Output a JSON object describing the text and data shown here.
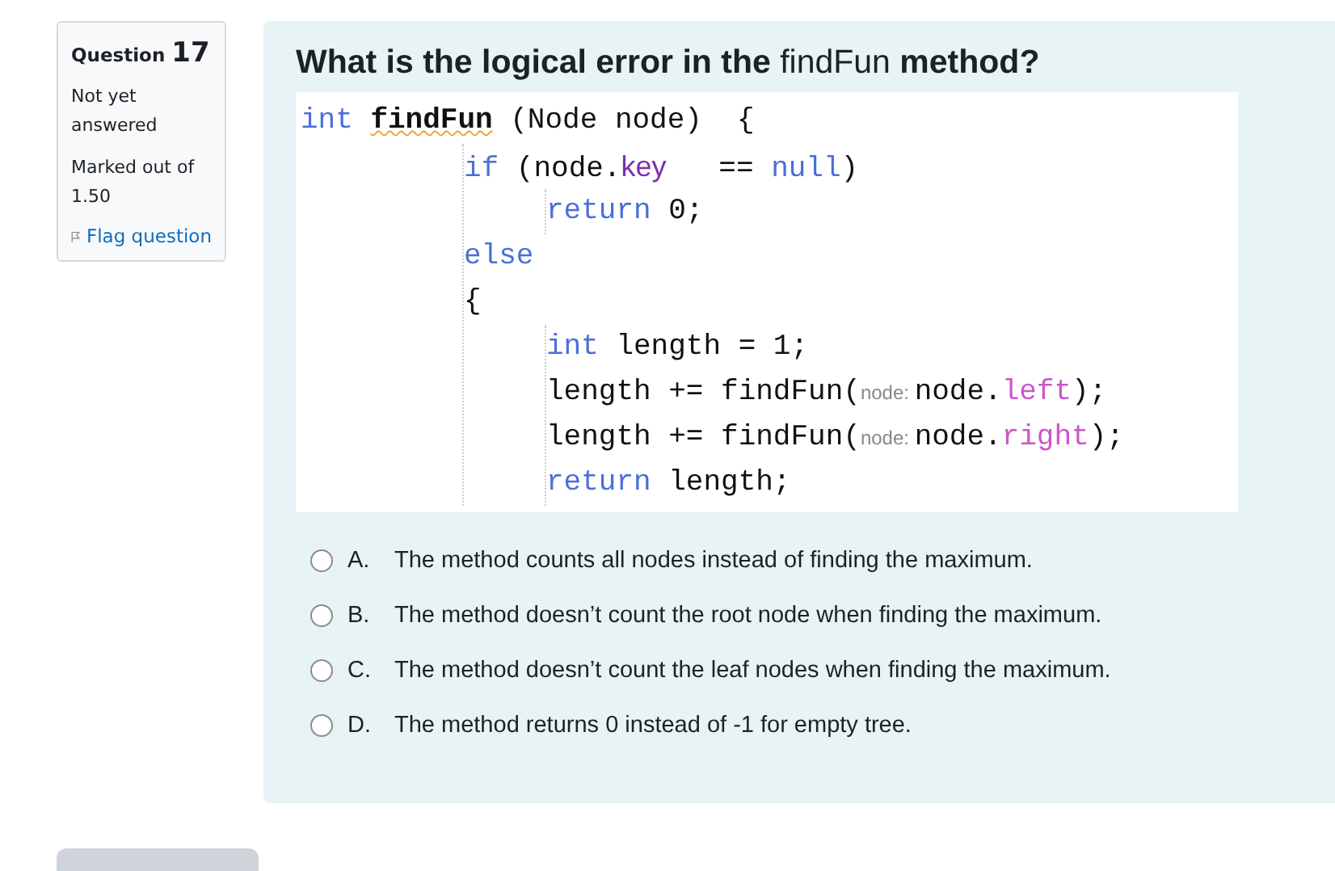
{
  "info": {
    "question_label": "Question",
    "question_number": "17",
    "status": "Not yet answered",
    "marks": "Marked out of 1.50",
    "flag": {
      "label": "Flag question",
      "flagged": false
    }
  },
  "question": {
    "title": "**What is the logical error in the** findFun **method?**",
    "code": [
      {
        "tokens": [
          {
            "kind": "keyword",
            "text": "int"
          },
          {
            "kind": "function",
            "text": "findFun"
          },
          {
            "kind": "plain",
            "text": " (Node node)  {"
          }
        ],
        "children": [
          {
            "tokens": [
              {
                "kind": "keyword",
                "text": "if"
              },
              {
                "kind": "plain",
                "text": " (node."
              },
              {
                "kind": "field",
                "text": "key"
              },
              {
                "kind": "plain",
                "text": "   == "
              },
              {
                "kind": "keyword",
                "text": "null"
              },
              {
                "kind": "plain",
                "text": ")"
              }
            ],
            "children": [
              {
                "tokens": [
                  {
                    "kind": "keyword",
                    "text": "return"
                  },
                  {
                    "kind": "plain",
                    "text": " 0;"
                  }
                ]
              }
            ]
          },
          {
            "tokens": [
              {
                "kind": "keyword",
                "text": "else"
              }
            ]
          },
          {
            "tokens": [
              {
                "kind": "plain",
                "text": "{"
              }
            ],
            "children": [
              {
                "tokens": [
                  {
                    "kind": "keyword",
                    "text": "int"
                  },
                  {
                    "kind": "plain",
                    "text": " length = 1;"
                  }
                ]
              },
              {
                "tokens": [
                  {
                    "kind": "plain",
                    "text": "length += findFun("
                  },
                  {
                    "kind": "hint",
                    "text": "node: "
                  },
                  {
                    "kind": "plain",
                    "text": "node."
                  },
                  {
                    "kind": "member",
                    "text": "left"
                  },
                  {
                    "kind": "plain",
                    "text": ");"
                  }
                ]
              },
              {
                "tokens": [
                  {
                    "kind": "plain",
                    "text": "length += findFun("
                  },
                  {
                    "kind": "hint",
                    "text": "node: "
                  },
                  {
                    "kind": "plain",
                    "text": "node."
                  },
                  {
                    "kind": "member",
                    "text": "right"
                  },
                  {
                    "kind": "plain",
                    "text": ");"
                  }
                ]
              },
              {
                "tokens": [
                  {
                    "kind": "keyword",
                    "text": "return"
                  },
                  {
                    "kind": "plain",
                    "text": " length;"
                  }
                ]
              }
            ]
          }
        ]
      }
    ],
    "options": [
      {
        "letter": "A.",
        "text": "The method counts all nodes instead of finding the maximum.",
        "selected": false
      },
      {
        "letter": "B.",
        "text": "The method doesn’t count the root node when finding the maximum.",
        "selected": false
      },
      {
        "letter": "C.",
        "text": "The method doesn’t count the leaf nodes when finding the maximum.",
        "selected": false
      },
      {
        "letter": "D.",
        "text": "The method returns 0 instead of -1 for empty tree.",
        "selected": false
      }
    ]
  }
}
